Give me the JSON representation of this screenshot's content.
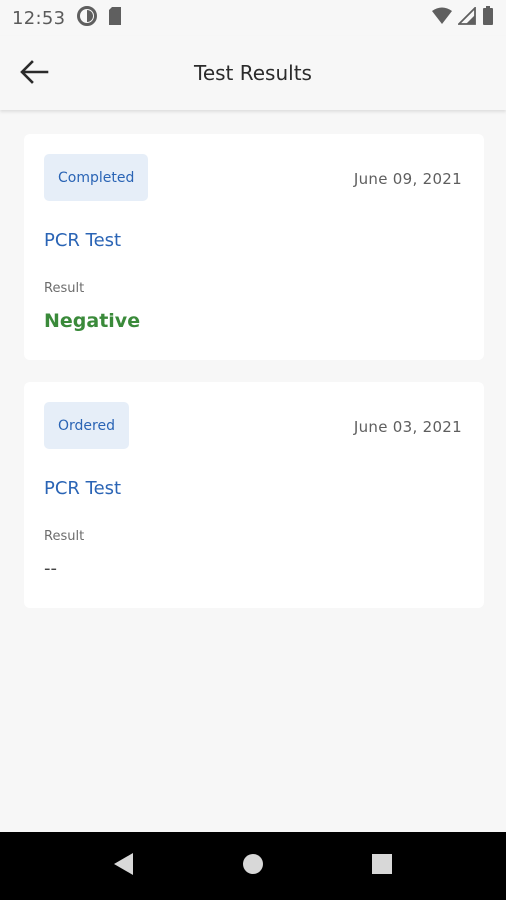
{
  "status_bar": {
    "time": "12:53",
    "left_icons": [
      "data-saver-icon",
      "sd-card-icon"
    ],
    "right_icons": [
      "wifi-icon",
      "signal-icon",
      "battery-icon"
    ]
  },
  "appbar": {
    "title": "Test Results",
    "back_icon": "arrow-back-icon"
  },
  "results": [
    {
      "status": "Completed",
      "date": "June 09, 2021",
      "test": "PCR Test",
      "result_label": "Result",
      "result_value": "Negative"
    },
    {
      "status": "Ordered",
      "date": "June 03, 2021",
      "test": "PCR Test",
      "result_label": "Result",
      "result_value": "--"
    }
  ],
  "colors": {
    "accent": "#2a64b5",
    "badge_bg": "#e6eef8",
    "negative": "#3a8a3a",
    "background": "#f7f7f7"
  },
  "nav_bar": {
    "icons": [
      "back-triangle-icon",
      "home-circle-icon",
      "recents-square-icon"
    ]
  }
}
